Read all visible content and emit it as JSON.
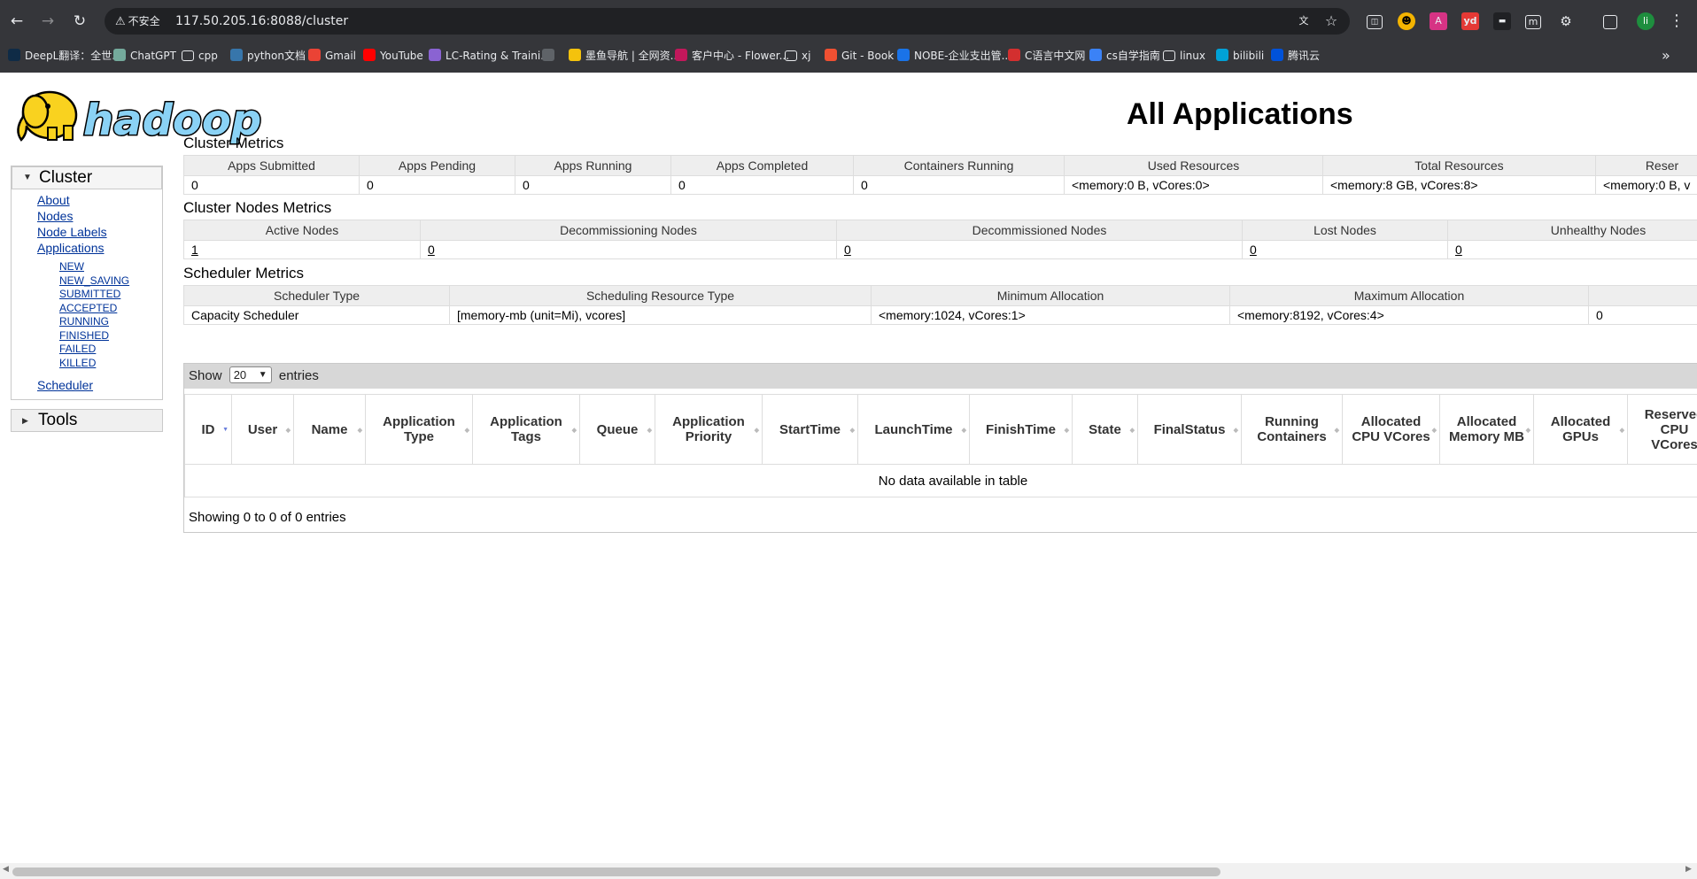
{
  "browser": {
    "security_label": "不安全",
    "url": "117.50.205.16:8088/cluster",
    "profile_initial": "li",
    "bookmarks": [
      {
        "label": "DeepL翻译：全世...",
        "icon": "deepl-icon",
        "color": "#0f2b46"
      },
      {
        "label": "ChatGPT",
        "icon": "chatgpt-icon",
        "color": "#74aa9c"
      },
      {
        "label": "cpp",
        "icon": "folder-icon",
        "color": "#35363a"
      },
      {
        "label": "python文档",
        "icon": "python-icon",
        "color": "#3776ab"
      },
      {
        "label": "Gmail",
        "icon": "gmail-icon",
        "color": "#ea4335"
      },
      {
        "label": "YouTube",
        "icon": "youtube-icon",
        "color": "#ff0000"
      },
      {
        "label": "LC-Rating & Traini...",
        "icon": "lc-rating-icon",
        "color": "#8a63d2"
      },
      {
        "label": "",
        "icon": "bookmark-m-icon",
        "color": "#5f6368"
      },
      {
        "label": "墨鱼导航 | 全网资...",
        "icon": "moyu-icon",
        "color": "#f4c20d"
      },
      {
        "label": "客户中心 - Flower...",
        "icon": "flower-icon",
        "color": "#c2185b"
      },
      {
        "label": "xj",
        "icon": "folder-icon",
        "color": "#35363a"
      },
      {
        "label": "Git - Book",
        "icon": "git-icon",
        "color": "#f05032"
      },
      {
        "label": "NOBE-企业支出管...",
        "icon": "nobe-icon",
        "color": "#1a73e8"
      },
      {
        "label": "C语言中文网",
        "icon": "c-lang-icon",
        "color": "#d32f2f"
      },
      {
        "label": "cs自学指南",
        "icon": "cs-guide-icon",
        "color": "#3b82f6"
      },
      {
        "label": "linux",
        "icon": "folder-icon",
        "color": "#35363a"
      },
      {
        "label": "bilibili",
        "icon": "bilibili-icon",
        "color": "#00a1d6"
      },
      {
        "label": "腾讯云",
        "icon": "tencent-cloud-icon",
        "color": "#0052d9"
      }
    ]
  },
  "page": {
    "title": "All Applications",
    "logo_text": "hadoop"
  },
  "nav": {
    "cluster_label": "Cluster",
    "tools_label": "Tools",
    "level1": [
      "About",
      "Nodes",
      "Node Labels",
      "Applications"
    ],
    "states": [
      "NEW",
      "NEW_SAVING",
      "SUBMITTED",
      "ACCEPTED",
      "RUNNING",
      "FINISHED",
      "FAILED",
      "KILLED"
    ],
    "scheduler": "Scheduler"
  },
  "cluster_metrics": {
    "title": "Cluster Metrics",
    "headers": [
      "Apps Submitted",
      "Apps Pending",
      "Apps Running",
      "Apps Completed",
      "Containers Running",
      "Used Resources",
      "Total Resources",
      "Reser"
    ],
    "values": [
      "0",
      "0",
      "0",
      "0",
      "0",
      "<memory:0 B, vCores:0>",
      "<memory:8 GB, vCores:8>",
      "<memory:0 B, v"
    ]
  },
  "nodes_metrics": {
    "title": "Cluster Nodes Metrics",
    "headers": [
      "Active Nodes",
      "Decommissioning Nodes",
      "Decommissioned Nodes",
      "Lost Nodes",
      "Unhealthy Nodes"
    ],
    "values": [
      "1",
      "0",
      "0",
      "0",
      "0"
    ]
  },
  "scheduler_metrics": {
    "title": "Scheduler Metrics",
    "headers": [
      "Scheduler Type",
      "Scheduling Resource Type",
      "Minimum Allocation",
      "Maximum Allocation",
      ""
    ],
    "values": [
      "Capacity Scheduler",
      "[memory-mb (unit=Mi), vcores]",
      "<memory:1024, vCores:1>",
      "<memory:8192, vCores:4>",
      "0"
    ]
  },
  "apps_table": {
    "show_label": "Show",
    "entries_value": "20",
    "entries_label": "entries",
    "columns": [
      "ID",
      "User",
      "Name",
      "Application Type",
      "Application Tags",
      "Queue",
      "Application Priority",
      "StartTime",
      "LaunchTime",
      "FinishTime",
      "State",
      "FinalStatus",
      "Running Containers",
      "Allocated CPU VCores",
      "Allocated Memory MB",
      "Allocated GPUs",
      "Reserved CPU VCores"
    ],
    "empty_message": "No data available in table",
    "info": "Showing 0 to 0 of 0 entries"
  }
}
